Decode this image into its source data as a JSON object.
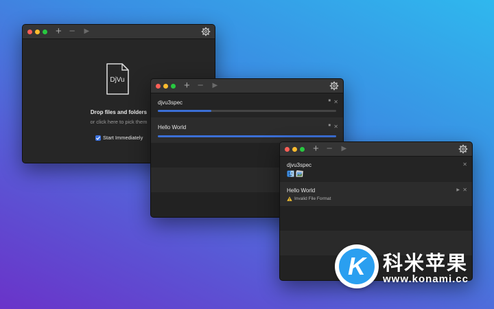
{
  "window1": {
    "toolbar": {
      "add_symbol": "+",
      "remove_symbol": "−",
      "start_symbol": "▶"
    },
    "drop": {
      "file_badge": "DjVu",
      "title": "Drop files and folders",
      "subtitle": "or click here to pick them",
      "checkbox_label": "Start Immediately",
      "checkbox_checked": true
    }
  },
  "window2": {
    "toolbar": {
      "add_symbol": "+",
      "remove_symbol": "−",
      "start_symbol": "▶"
    },
    "items": [
      {
        "name": "djvu3spec",
        "stop_symbol": "■",
        "close_symbol": "✕",
        "progress": 0.3
      },
      {
        "name": "Hello World",
        "stop_symbol": "■",
        "close_symbol": "✕",
        "progress": 1.0
      }
    ]
  },
  "window3": {
    "toolbar": {
      "add_symbol": "+",
      "remove_symbol": "−",
      "start_symbol": "▶"
    },
    "items": [
      {
        "name": "djvu3spec",
        "close_symbol": "✕",
        "result_icons": [
          "finder-icon",
          "preview-icon"
        ]
      },
      {
        "name": "Hello World",
        "play_symbol": "▶",
        "close_symbol": "✕",
        "warning_icon": "warning-icon",
        "status": "Invalid File Format"
      }
    ]
  },
  "watermark": {
    "brand": "科米苹果",
    "url": "www.konami.cc",
    "logo_letter": "K"
  },
  "colors": {
    "accent": "#3b6fd6",
    "window_bg": "#1f1f1f",
    "titlebar": "#353535"
  }
}
